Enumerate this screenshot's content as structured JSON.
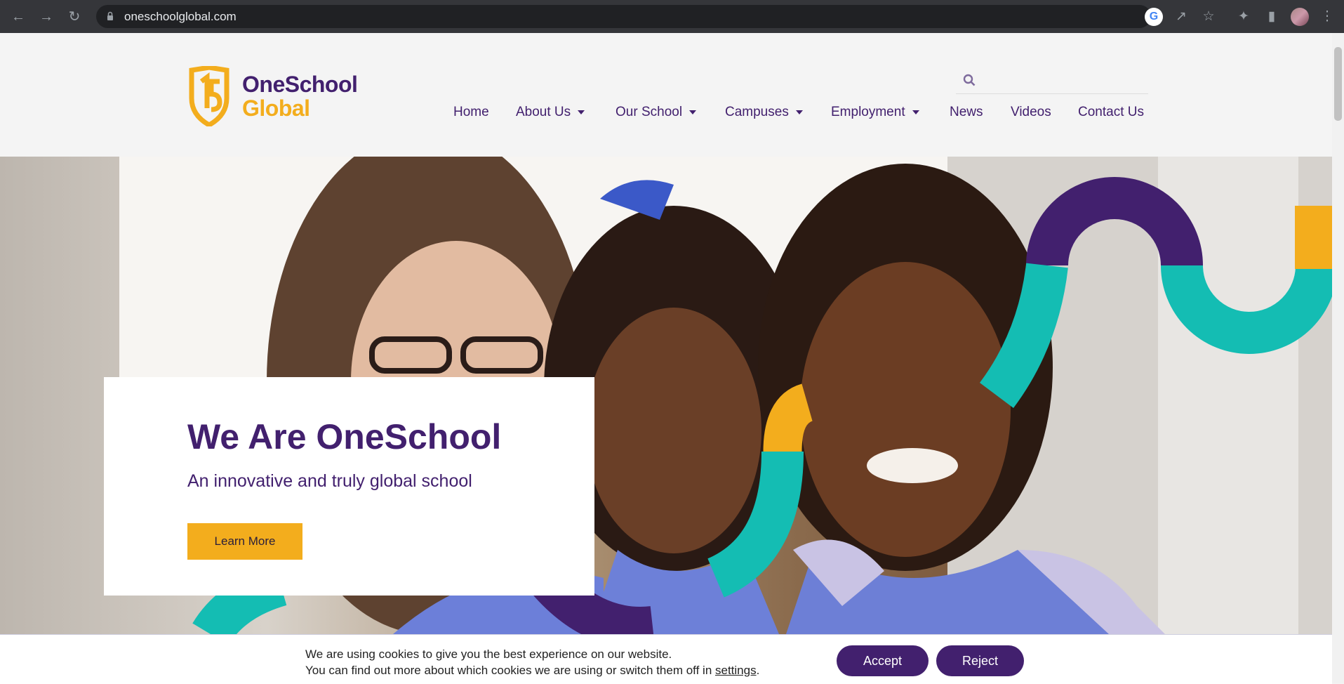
{
  "browser": {
    "url": "oneschoolglobal.com",
    "icons": [
      "back-icon",
      "forward-icon",
      "reload-icon",
      "lock-icon",
      "google-icon",
      "share-icon",
      "bookmark-star-icon",
      "extensions-icon",
      "side-panel-icon",
      "profile-avatar",
      "more-menu-icon"
    ]
  },
  "site": {
    "logo_line1": "OneSchool",
    "logo_line2": "Global",
    "search_placeholder": "",
    "nav": [
      {
        "label": "Home",
        "active": true,
        "dropdown": false
      },
      {
        "label": "About Us",
        "active": false,
        "dropdown": true
      },
      {
        "label": "Our School",
        "active": false,
        "dropdown": true
      },
      {
        "label": "Campuses",
        "active": false,
        "dropdown": true
      },
      {
        "label": "Employment",
        "active": false,
        "dropdown": true
      },
      {
        "label": "News",
        "active": false,
        "dropdown": false
      },
      {
        "label": "Videos",
        "active": false,
        "dropdown": false
      },
      {
        "label": "Contact Us",
        "active": false,
        "dropdown": false
      }
    ]
  },
  "hero": {
    "title": "We Are OneSchool",
    "subtitle": "An innovative and truly global school",
    "cta_label": "Learn More"
  },
  "cookie": {
    "line1": "We are using cookies to give you the best experience on our website.",
    "line2_prefix": "You can find out more about which cookies we are using or switch them off in ",
    "settings_link": "settings",
    "line2_suffix": ".",
    "accept_label": "Accept",
    "reject_label": "Reject"
  },
  "colors": {
    "brand_purple": "#42206e",
    "brand_yellow": "#f3ad1d",
    "brand_teal": "#14bdb3"
  }
}
